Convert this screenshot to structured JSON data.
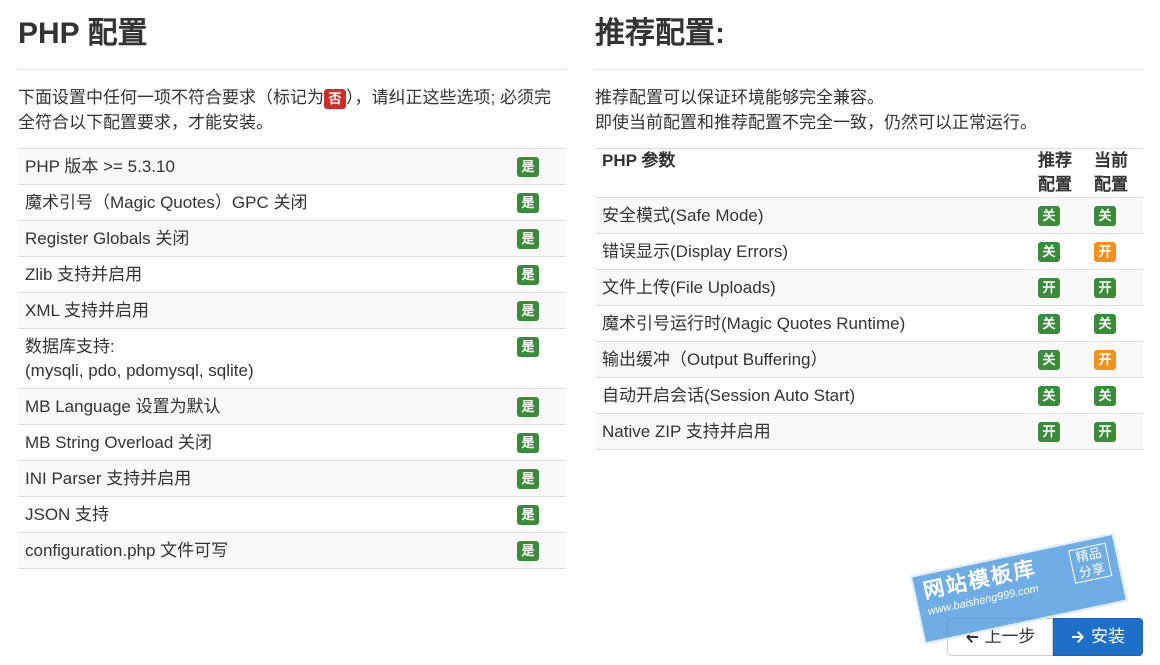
{
  "left": {
    "title": "PHP 配置",
    "desc_before": "下面设置中任何一项不符合要求（标记为",
    "desc_badge": "否",
    "desc_after": "），请纠正这些选项; 必须完全符合以下配置要求，才能安装。",
    "rows": [
      {
        "label": "PHP 版本 >= 5.3.10",
        "status": "是"
      },
      {
        "label": "魔术引号（Magic Quotes）GPC 关闭",
        "status": "是"
      },
      {
        "label": "Register Globals 关闭",
        "status": "是"
      },
      {
        "label": "Zlib 支持并启用",
        "status": "是"
      },
      {
        "label": "XML 支持并启用",
        "status": "是"
      },
      {
        "label": "数据库支持:",
        "label2": "(mysqli, pdo, pdomysql, sqlite)",
        "status": "是"
      },
      {
        "label": "MB Language 设置为默认",
        "status": "是"
      },
      {
        "label": "MB String Overload 关闭",
        "status": "是"
      },
      {
        "label": "INI Parser 支持并启用",
        "status": "是"
      },
      {
        "label": "JSON 支持",
        "status": "是"
      },
      {
        "label": "configuration.php 文件可写",
        "status": "是"
      }
    ]
  },
  "right": {
    "title": "推荐配置:",
    "desc_line1": "推荐配置可以保证环境能够完全兼容。",
    "desc_line2": "即使当前配置和推荐配置不完全一致，仍然可以正常运行。",
    "headers": {
      "param": "PHP 参数",
      "recommended": "推荐配置",
      "current": "当前配置"
    },
    "rows": [
      {
        "label": "安全模式(Safe Mode)",
        "recommended": "关",
        "current": "关",
        "current_state": "ok"
      },
      {
        "label": "错误显示(Display Errors)",
        "recommended": "关",
        "current": "开",
        "current_state": "warn"
      },
      {
        "label": "文件上传(File Uploads)",
        "recommended": "开",
        "current": "开",
        "current_state": "ok"
      },
      {
        "label": "魔术引号运行时(Magic Quotes Runtime)",
        "recommended": "关",
        "current": "关",
        "current_state": "ok"
      },
      {
        "label": "输出缓冲（Output Buffering）",
        "recommended": "关",
        "current": "开",
        "current_state": "warn"
      },
      {
        "label": "自动开启会话(Session Auto Start)",
        "recommended": "关",
        "current": "关",
        "current_state": "ok"
      },
      {
        "label": "Native ZIP 支持并启用",
        "recommended": "开",
        "current": "开",
        "current_state": "ok"
      }
    ]
  },
  "actions": {
    "prev_label": "上一步",
    "install_label": "安装"
  },
  "watermark": {
    "main": "网站模板库",
    "url": "www.baisheng999.com",
    "tag": "精品分享"
  },
  "colors": {
    "success": "#3c8a3c",
    "warning": "#f0921e",
    "danger": "#c9302c",
    "primary": "#1e6fc8"
  }
}
